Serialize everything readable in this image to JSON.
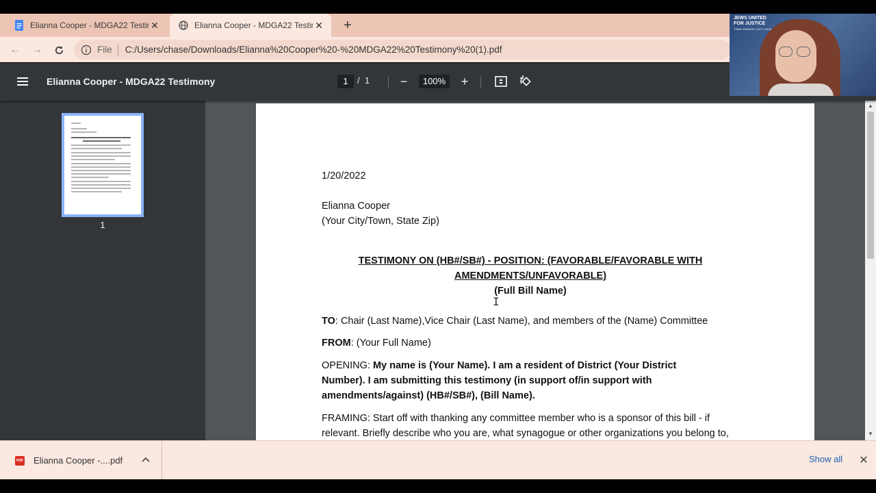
{
  "browser": {
    "tabs": [
      {
        "title": "Elianna Cooper - MDGA22 Testim",
        "icon": "google-docs-icon",
        "active": false
      },
      {
        "title": "Elianna Cooper - MDGA22 Testim",
        "icon": "globe-icon",
        "active": true
      }
    ],
    "address": {
      "protocol_label": "File",
      "url": "C:/Users/chase/Downloads/Elianna%20Cooper%20-%20MDGA22%20Testimony%20(1).pdf"
    }
  },
  "pdf_viewer": {
    "title": "Elianna Cooper - MDGA22 Testimony",
    "current_page": "1",
    "page_separator": "/",
    "total_pages": "1",
    "zoom": "100%",
    "thumbnail_page_number": "1"
  },
  "document": {
    "date": "1/20/2022",
    "author_name": "Elianna Cooper",
    "author_location": "(Your City/Town, State Zip)",
    "heading_line1": "TESTIMONY ON (HB#/SB#) - POSITION: (FAVORABLE/FAVORABLE WITH",
    "heading_line2": "AMENDMENTS/UNFAVORABLE)",
    "subheading": "(Full Bill Name)",
    "to_label": "TO",
    "to_text": ": Chair (Last Name),Vice Chair (Last Name), and  members of the (Name) Committee",
    "from_label": "FROM",
    "from_text": ": (Your Full Name)",
    "opening_label": "OPENING: ",
    "opening_line1": "My name is (Your Name). I am a resident of District (Your District",
    "opening_line2": "Number). I am submitting this testimony (in support of/in support with",
    "opening_line3": "amendments/against) (HB#/SB#), (Bill Name).",
    "framing_line1": "FRAMING: Start off with thanking any committee member who is a sponsor of this bill - if",
    "framing_line2": "relevant. Briefly describe who you are, what synagogue or other organizations you belong to,"
  },
  "downloads": {
    "file_name": "Elianna Cooper -....pdf",
    "file_icon_label": "PDF",
    "show_all_label": "Show all"
  },
  "webcam": {
    "logo_line1": "JEWS UNITED",
    "logo_line2": "FOR JUSTICE",
    "logo_tagline": "THINK JEWISHLY. ACT LOCALLY."
  }
}
